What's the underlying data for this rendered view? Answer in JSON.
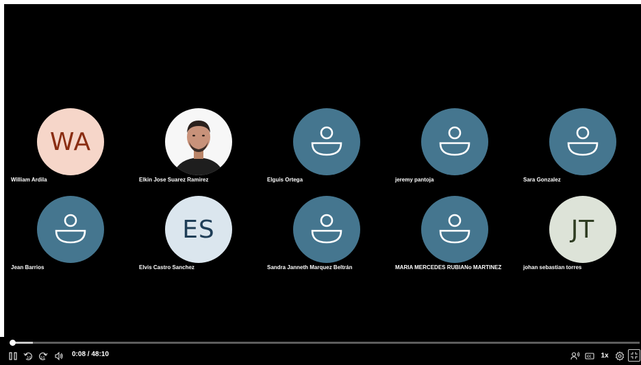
{
  "participants": [
    {
      "name": "William Ardila",
      "avatar_type": "initials",
      "initials": "WA",
      "bg": "#f6d6c9",
      "fg": "#8a2d12"
    },
    {
      "name": "Elkin Jose Suarez Ramirez",
      "avatar_type": "photo"
    },
    {
      "name": "Elguis Ortega",
      "avatar_type": "generic",
      "icon": "person-icon"
    },
    {
      "name": "jeremy pantoja",
      "avatar_type": "generic",
      "icon": "person-icon"
    },
    {
      "name": "Sara Gonzalez",
      "avatar_type": "generic",
      "icon": "person-icon"
    },
    {
      "name": "Jean Barrios",
      "avatar_type": "generic",
      "icon": "person-icon"
    },
    {
      "name": "Elvis  Castro Sanchez",
      "avatar_type": "initials",
      "initials": "ES",
      "bg": "#dbe6ee",
      "fg": "#1f3e57"
    },
    {
      "name": "Sandra Janneth Marquez Beltrán",
      "avatar_type": "generic",
      "icon": "person-icon"
    },
    {
      "name": "MARIA MERCEDES RUBIANo MARTINEZ",
      "avatar_type": "generic",
      "icon": "person-icon"
    },
    {
      "name": "johan sebastian torres",
      "avatar_type": "initials",
      "initials": "JT",
      "bg": "#dde3d8",
      "fg": "#2f3d22"
    }
  ],
  "player": {
    "time_display": "0:08 / 48:10",
    "progress_fraction": 0.003,
    "speed_label": "1x",
    "controls": [
      "play-pause-icon",
      "rewind-10-icon",
      "forward-10-icon",
      "volume-icon",
      "speaker-icon",
      "captions-icon",
      "settings-icon",
      "fullscreen-icon"
    ]
  },
  "colors": {
    "background": "#000000",
    "generic_avatar": "#45768f",
    "text": "#ffffff"
  }
}
